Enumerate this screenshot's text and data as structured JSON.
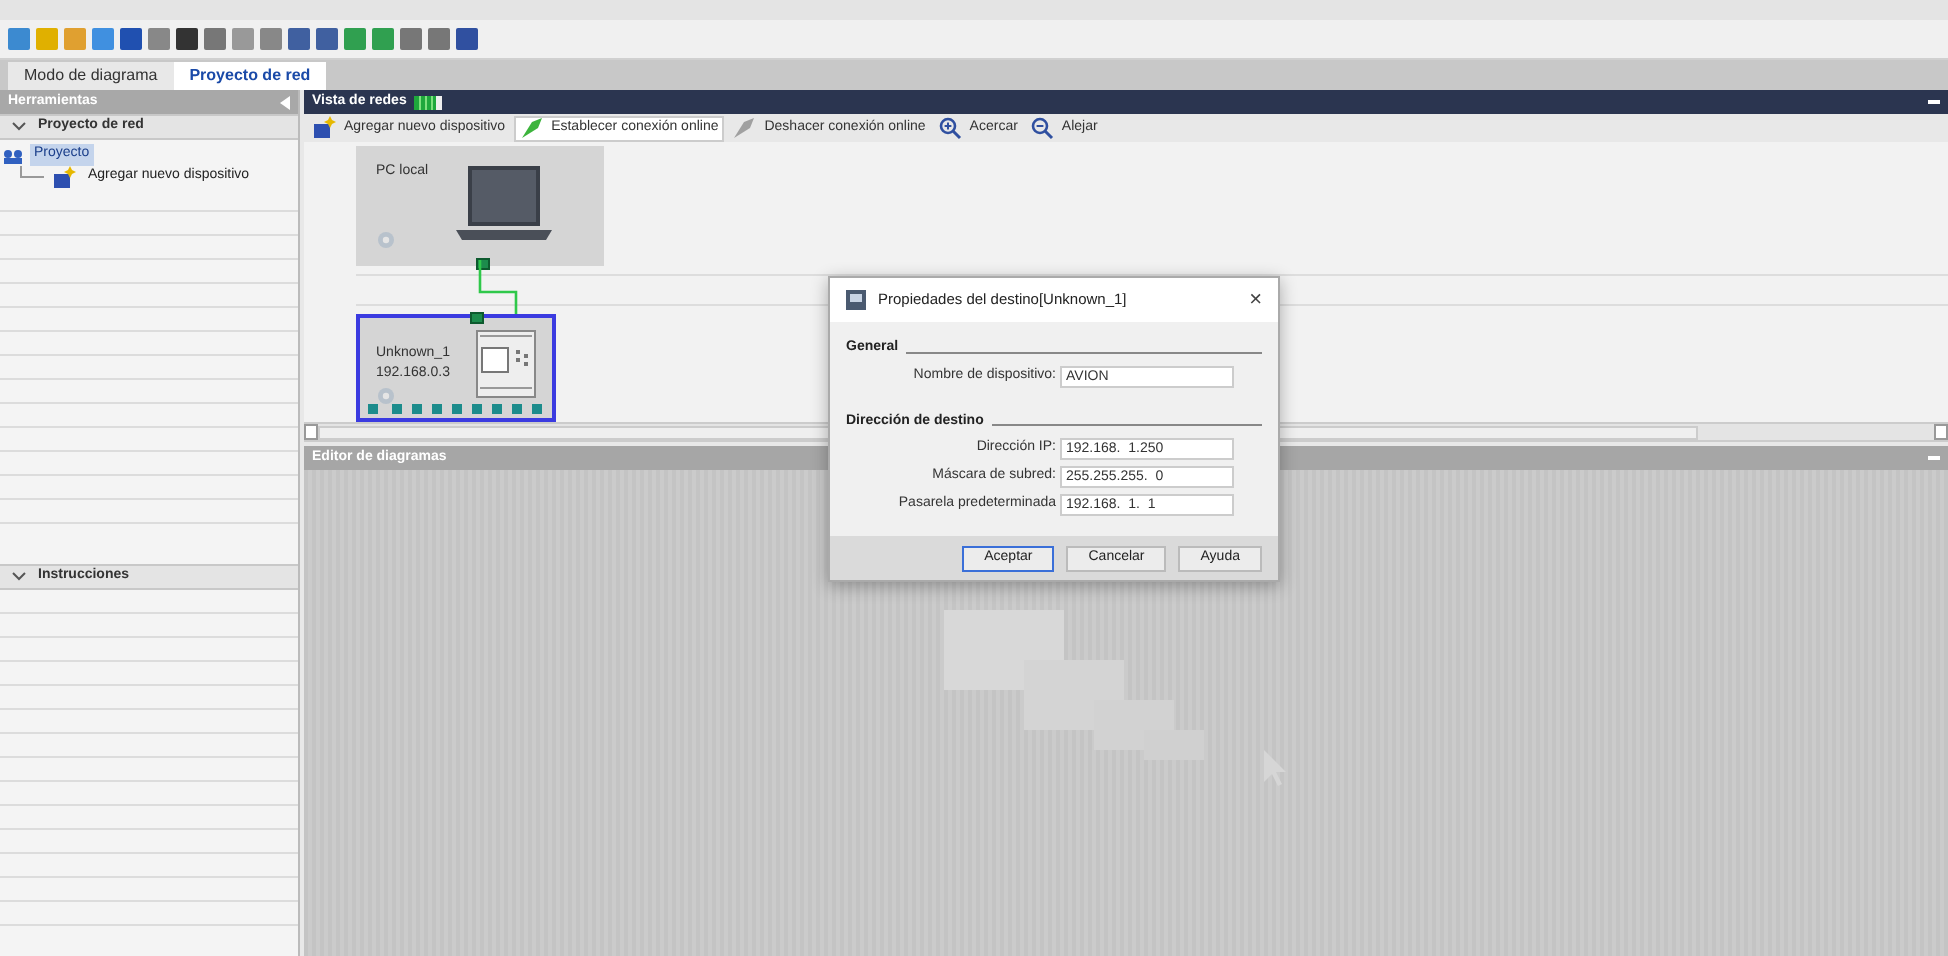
{
  "tabs": [
    {
      "label": "Modo de diagrama",
      "selected": false
    },
    {
      "label": "Proyecto de red",
      "selected": true
    }
  ],
  "left_panel": {
    "title": "Herramientas",
    "sections": [
      {
        "title": "Proyecto de red",
        "expanded": true,
        "tree": [
          {
            "label": "Proyecto",
            "selected": true,
            "children": [
              {
                "label": "Agregar nuevo dispositivo",
                "selected": false
              }
            ]
          }
        ]
      },
      {
        "title": "Instrucciones",
        "expanded": true
      }
    ]
  },
  "network_view": {
    "title": "Vista de redes",
    "toolbar": [
      {
        "label": "Agregar nuevo dispositivo",
        "kind": "add",
        "selected": false
      },
      {
        "label": "Establecer conexión online",
        "kind": "connect",
        "selected": true
      },
      {
        "label": "Deshacer conexión online",
        "kind": "disconnect",
        "selected": false
      },
      {
        "label": "Acercar",
        "kind": "zoom-in",
        "selected": false
      },
      {
        "label": "Alejar",
        "kind": "zoom-out",
        "selected": false
      }
    ],
    "devices": [
      {
        "kind": "pc",
        "name": "PC local",
        "selected": false
      },
      {
        "kind": "plc",
        "name": "Unknown_1",
        "address": "192.168.0.3",
        "selected": true
      }
    ]
  },
  "editor": {
    "title": "Editor de diagramas"
  },
  "dialog": {
    "title": "Propiedades del destino[Unknown_1]",
    "close": "×",
    "groups": [
      {
        "title": "General",
        "fields": [
          {
            "label": "Nombre de dispositivo:",
            "value": "AVION"
          }
        ]
      },
      {
        "title": "Dirección de destino",
        "fields": [
          {
            "label": "Dirección IP:",
            "value": "192.168.  1.250"
          },
          {
            "label": "Máscara de subred:",
            "value": "255.255.255.  0"
          },
          {
            "label": "Pasarela predeterminada",
            "value": "192.168.  1.  1"
          }
        ]
      }
    ],
    "buttons": [
      {
        "label": "Aceptar",
        "selected": true
      },
      {
        "label": "Cancelar",
        "selected": false
      },
      {
        "label": "Ayuda",
        "selected": false
      }
    ]
  }
}
